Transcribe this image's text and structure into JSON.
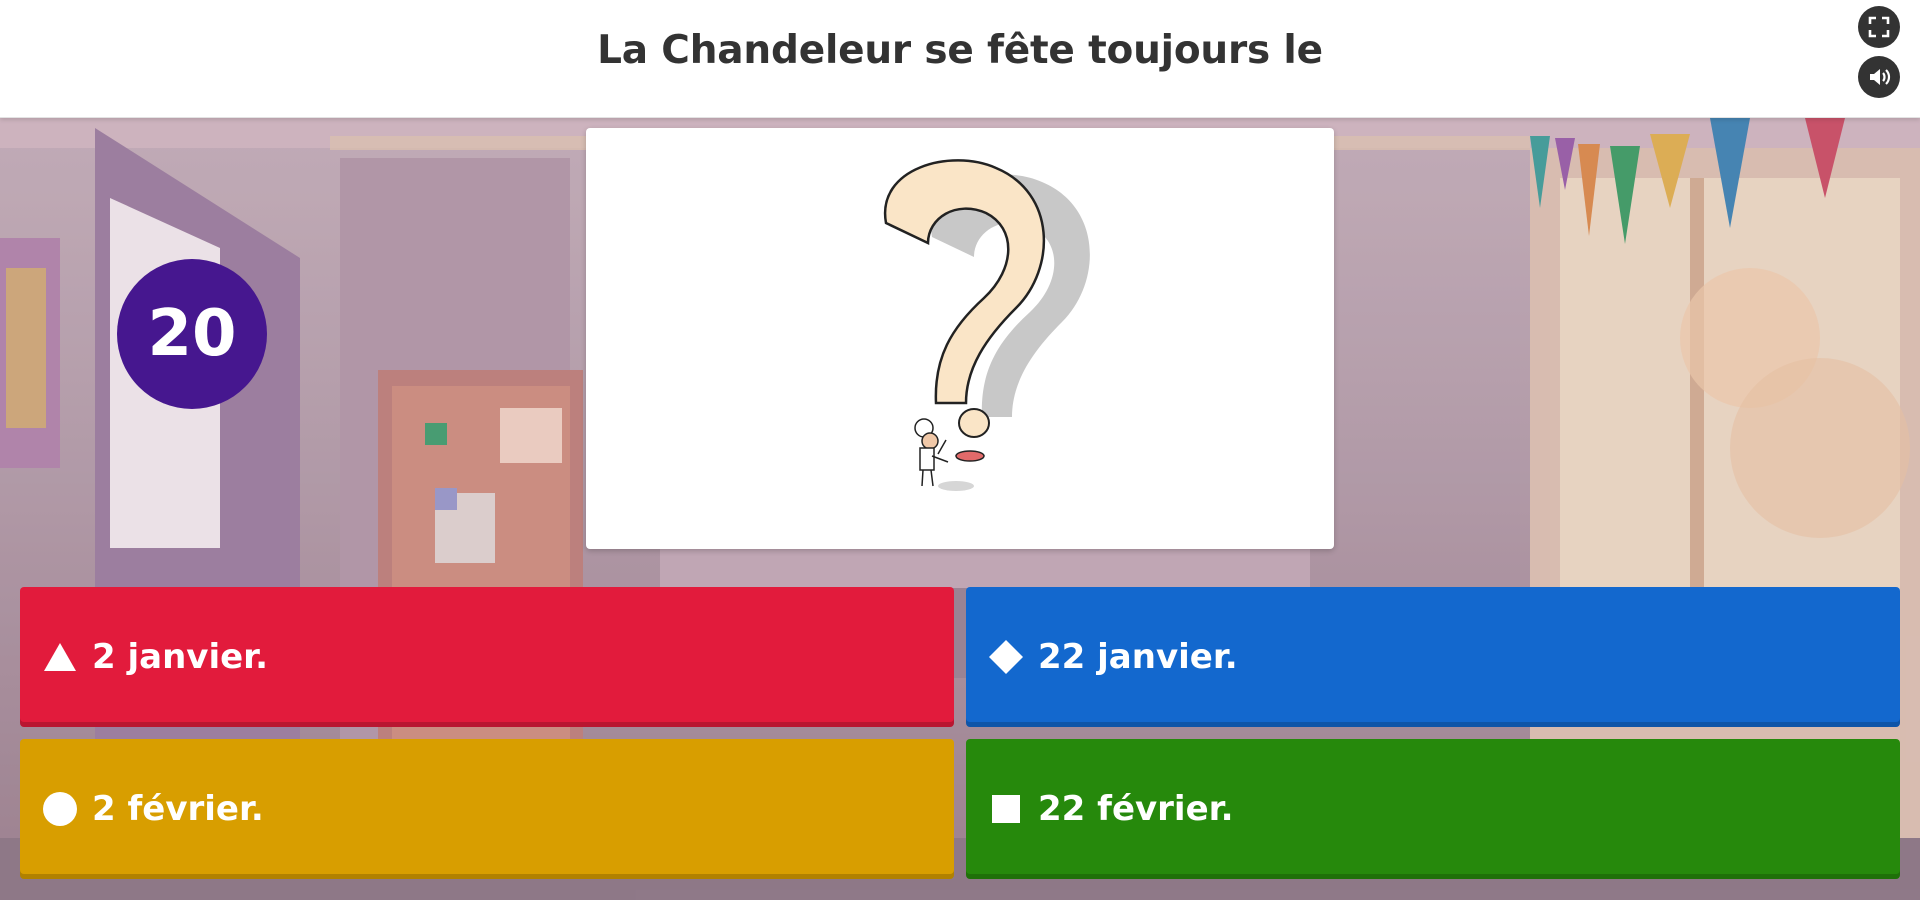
{
  "header": {
    "question": "La Chandeleur se fête toujours le",
    "fullscreen_icon": "fullscreen-icon",
    "sound_icon": "speaker-icon"
  },
  "timer": {
    "value": "20",
    "color": "#46178f"
  },
  "media": {
    "image": "question-mark-chef-flipping-crepe-illustration"
  },
  "answers": [
    {
      "label": "2 janvier.",
      "shape": "triangle-icon",
      "color": "#e21b3c"
    },
    {
      "label": "22 janvier.",
      "shape": "diamond-icon",
      "color": "#1368ce"
    },
    {
      "label": "2 février.",
      "shape": "circle-icon",
      "color": "#d89e00"
    },
    {
      "label": "22 février.",
      "shape": "square-icon",
      "color": "#26890c"
    }
  ]
}
